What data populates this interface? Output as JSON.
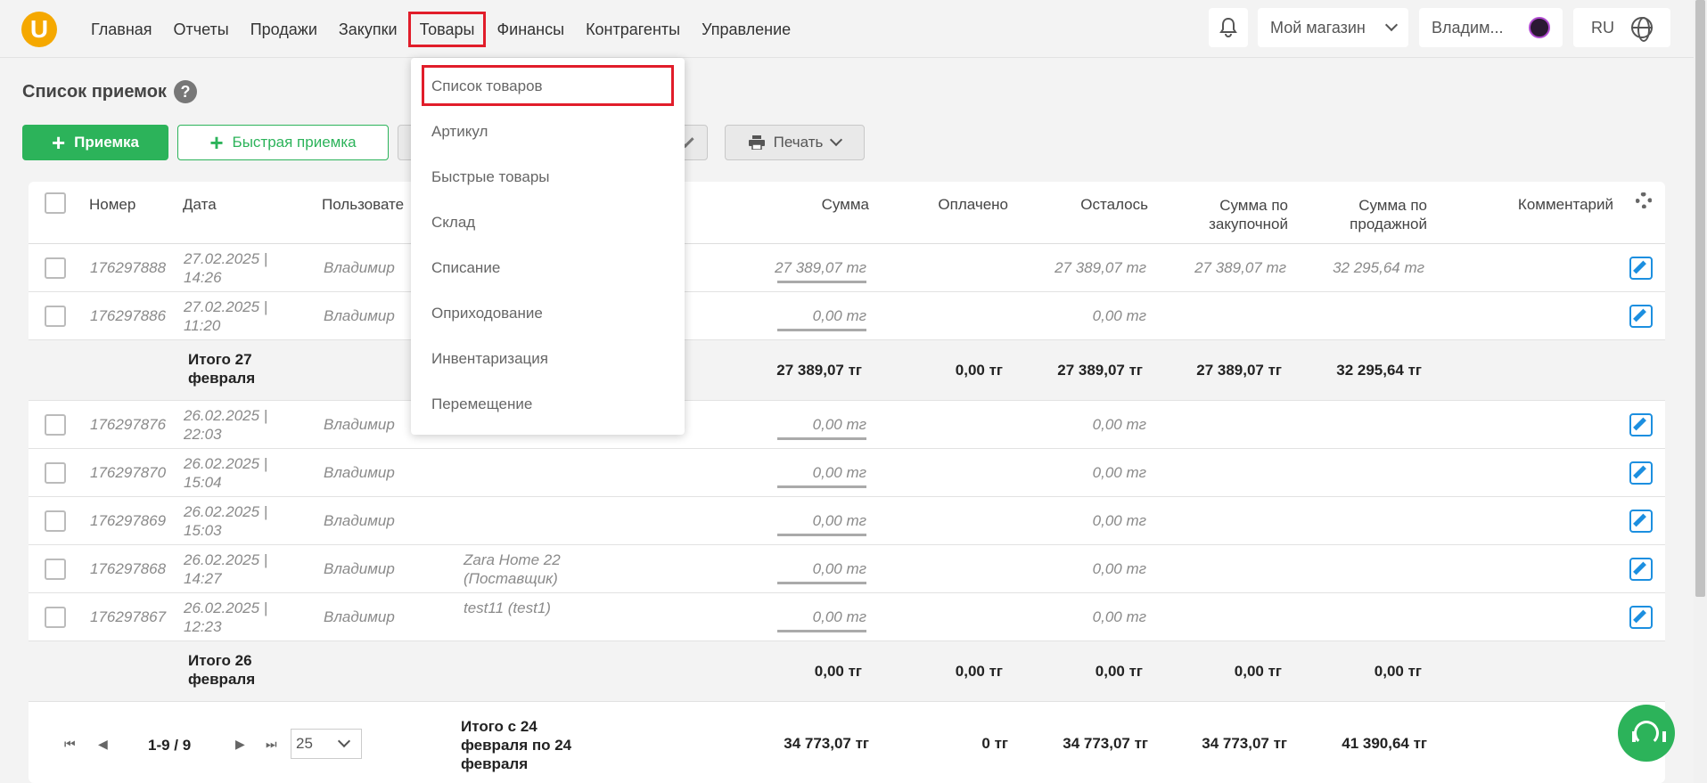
{
  "logo": "U",
  "nav": [
    "Главная",
    "Отчеты",
    "Продажи",
    "Закупки",
    "Товары",
    "Финансы",
    "Контрагенты",
    "Управление"
  ],
  "top_right": {
    "shop": "Мой магазин",
    "user": "Владим...",
    "lang": "RU"
  },
  "page_title": "Список приемок",
  "buttons": {
    "receive": "Приемка",
    "quick_receive": "Быстрая приемка",
    "print": "Печать"
  },
  "dropdown": [
    "Список товаров",
    "Артикул",
    "Быстрые товары",
    "Склад",
    "Списание",
    "Оприходование",
    "Инвентаризация",
    "Перемещение"
  ],
  "headers": {
    "number": "Номер",
    "date": "Дата",
    "user": "Пользовате",
    "sum": "Сумма",
    "paid": "Оплачено",
    "left": "Осталось",
    "sum_purchase_1": "Сумма по",
    "sum_purchase_2": "закупочной",
    "sum_sale_1": "Сумма по",
    "sum_sale_2": "продажной",
    "comment": "Комментарий"
  },
  "rows": [
    {
      "num": "176297888",
      "date1": "27.02.2025 |",
      "date2": "14:26",
      "user": "Владимир",
      "supplier1": "",
      "supplier2": "",
      "sum": "27 389,07 тг",
      "left": "27 389,07 тг",
      "purchase": "27 389,07 тг",
      "sale": "32 295,64 тг"
    },
    {
      "num": "176297886",
      "date1": "27.02.2025 |",
      "date2": "11:20",
      "user": "Владимир",
      "supplier1": "",
      "supplier2": "",
      "sum": "0,00 тг",
      "left": "0,00 тг",
      "purchase": "",
      "sale": ""
    },
    {
      "num": "176297876",
      "date1": "26.02.2025 |",
      "date2": "22:03",
      "user": "Владимир",
      "supplier1": "",
      "supplier2": "",
      "sum": "0,00 тг",
      "left": "0,00 тг",
      "purchase": "",
      "sale": ""
    },
    {
      "num": "176297870",
      "date1": "26.02.2025 |",
      "date2": "15:04",
      "user": "Владимир",
      "supplier1": "",
      "supplier2": "",
      "sum": "0,00 тг",
      "left": "0,00 тг",
      "purchase": "",
      "sale": ""
    },
    {
      "num": "176297869",
      "date1": "26.02.2025 |",
      "date2": "15:03",
      "user": "Владимир",
      "supplier1": "",
      "supplier2": "",
      "sum": "0,00 тг",
      "left": "0,00 тг",
      "purchase": "",
      "sale": ""
    },
    {
      "num": "176297868",
      "date1": "26.02.2025 |",
      "date2": "14:27",
      "user": "Владимир",
      "supplier1": "Zara Home 22",
      "supplier2": "(Поставщик)",
      "sum": "0,00 тг",
      "left": "0,00 тг",
      "purchase": "",
      "sale": ""
    },
    {
      "num": "176297867",
      "date1": "26.02.2025 |",
      "date2": "12:23",
      "user": "Владимир",
      "supplier1": "test11 (test1)",
      "supplier2": "",
      "sum": "0,00 тг",
      "left": "0,00 тг",
      "purchase": "",
      "sale": ""
    }
  ],
  "totals": [
    {
      "label1": "Итого 27",
      "label2": "февраля",
      "label3": "",
      "sum": "27 389,07 тг",
      "paid": "0,00 тг",
      "left": "27 389,07 тг",
      "purchase": "27 389,07 тг",
      "sale": "32 295,64 тг"
    },
    {
      "label1": "Итого 26",
      "label2": "февраля",
      "label3": "",
      "sum": "0,00 тг",
      "paid": "0,00 тг",
      "left": "0,00 тг",
      "purchase": "0,00 тг",
      "sale": "0,00 тг"
    },
    {
      "label1": "Итого с 24",
      "label2": "февраля по 24",
      "label3": "февраля",
      "sum": "34 773,07 тг",
      "paid": "0 тг",
      "left": "34 773,07 тг",
      "purchase": "34 773,07 тг",
      "sale": "41 390,64 тг"
    }
  ],
  "pager": {
    "range": "1-9 / 9",
    "per_page": "25"
  }
}
